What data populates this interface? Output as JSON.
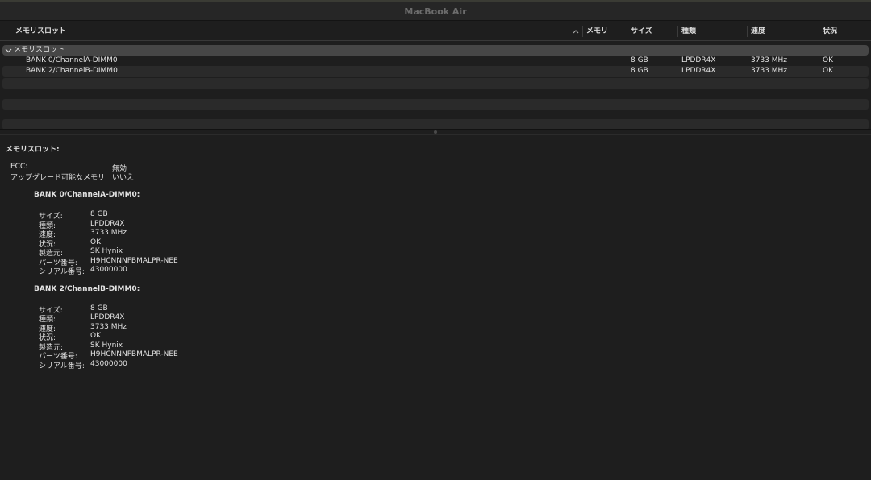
{
  "window": {
    "title": "MacBook Air"
  },
  "table": {
    "headers": {
      "slot": "メモリスロット",
      "memory": "メモリ",
      "size": "サイズ",
      "type": "種類",
      "speed": "速度",
      "status": "状況"
    },
    "group": {
      "label": "メモリスロット"
    },
    "rows": [
      {
        "name": "BANK 0/ChannelA-DIMM0",
        "size": "8 GB",
        "type": "LPDDR4X",
        "speed": "3733 MHz",
        "status": "OK"
      },
      {
        "name": "BANK 2/ChannelB-DIMM0",
        "size": "8 GB",
        "type": "LPDDR4X",
        "speed": "3733 MHz",
        "status": "OK"
      }
    ]
  },
  "detail": {
    "heading": "メモリスロット:",
    "summary": [
      {
        "label": "ECC:",
        "value": "無効"
      },
      {
        "label": "アップグレード可能なメモリ:",
        "value": "いいえ"
      }
    ],
    "banks": [
      {
        "title": "BANK 0/ChannelA-DIMM0:",
        "fields": [
          {
            "label": "サイズ:",
            "value": "8 GB"
          },
          {
            "label": "種類:",
            "value": "LPDDR4X"
          },
          {
            "label": "速度:",
            "value": "3733 MHz"
          },
          {
            "label": "状況:",
            "value": "OK"
          },
          {
            "label": "製造元:",
            "value": "SK Hynix"
          },
          {
            "label": "パーツ番号:",
            "value": "H9HCNNNFBMALPR-NEE"
          },
          {
            "label": "シリアル番号:",
            "value": "43000000"
          }
        ]
      },
      {
        "title": "BANK 2/ChannelB-DIMM0:",
        "fields": [
          {
            "label": "サイズ:",
            "value": "8 GB"
          },
          {
            "label": "種類:",
            "value": "LPDDR4X"
          },
          {
            "label": "速度:",
            "value": "3733 MHz"
          },
          {
            "label": "状況:",
            "value": "OK"
          },
          {
            "label": "製造元:",
            "value": "SK Hynix"
          },
          {
            "label": "パーツ番号:",
            "value": "H9HCNNNFBMALPR-NEE"
          },
          {
            "label": "シリアル番号:",
            "value": "43000000"
          }
        ]
      }
    ]
  },
  "icons": {
    "sort": "chevron-up-icon",
    "disclosure": "chevron-down-icon"
  },
  "colors": {
    "background": "#1e1e1e",
    "group_row": "#464646",
    "stripe": "#2a2a2a",
    "title_text": "#6c6c6c"
  }
}
